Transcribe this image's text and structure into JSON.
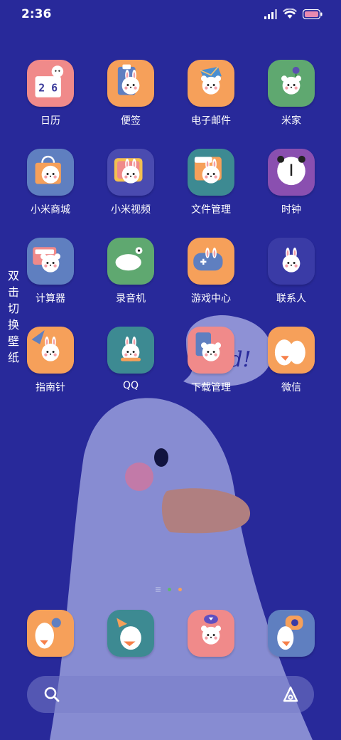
{
  "status_bar": {
    "time": "2:36"
  },
  "wallpaper": {
    "side_hint": "双击切换壁纸",
    "bubble_text": "Gd!"
  },
  "apps": [
    {
      "label": "日历",
      "icon": "calendar-icon",
      "icon_number": "2 6",
      "bg": "#f08a8a"
    },
    {
      "label": "便签",
      "icon": "notes-icon",
      "bg": "#f6a05a"
    },
    {
      "label": "电子邮件",
      "icon": "email-icon",
      "bg": "#f6a05a"
    },
    {
      "label": "米家",
      "icon": "mijia-icon",
      "bg": "#5fa870"
    },
    {
      "label": "小米商城",
      "icon": "mi-store-icon",
      "bg": "#5f7fc0"
    },
    {
      "label": "小米视频",
      "icon": "mi-video-icon",
      "bg": "#4a4bb0"
    },
    {
      "label": "文件管理",
      "icon": "file-manager-icon",
      "bg": "#3d8a92"
    },
    {
      "label": "时钟",
      "icon": "clock-icon",
      "bg": "#8a4fb0"
    },
    {
      "label": "计算器",
      "icon": "calculator-icon",
      "bg": "#5f7fc0"
    },
    {
      "label": "录音机",
      "icon": "recorder-icon",
      "bg": "#5fa870"
    },
    {
      "label": "游戏中心",
      "icon": "game-center-icon",
      "bg": "#f6a05a"
    },
    {
      "label": "联系人",
      "icon": "contacts-icon",
      "bg": "#3a3ba6"
    },
    {
      "label": "指南针",
      "icon": "compass-icon",
      "bg": "#f6a05a"
    },
    {
      "label": "QQ",
      "icon": "qq-icon",
      "bg": "#3d8a92"
    },
    {
      "label": "下载管理",
      "icon": "download-manager-icon",
      "bg": "#f08a8a"
    },
    {
      "label": "微信",
      "icon": "wechat-icon",
      "bg": "#f6a05a"
    }
  ],
  "dock": [
    {
      "icon": "phone-icon",
      "bg": "#f6a05a"
    },
    {
      "icon": "messages-icon",
      "bg": "#3d8a92"
    },
    {
      "icon": "browser-icon",
      "bg": "#f08a8a"
    },
    {
      "icon": "camera-icon",
      "bg": "#5f7fc0"
    }
  ],
  "page_indicator": {
    "colors": [
      "#aab0e0",
      "#5fb870",
      "#f6a05a"
    ]
  },
  "colors": {
    "background": "#28299a",
    "goose": "#8f93d6",
    "beak": "#b08080",
    "cheek": "#c27aa8"
  }
}
